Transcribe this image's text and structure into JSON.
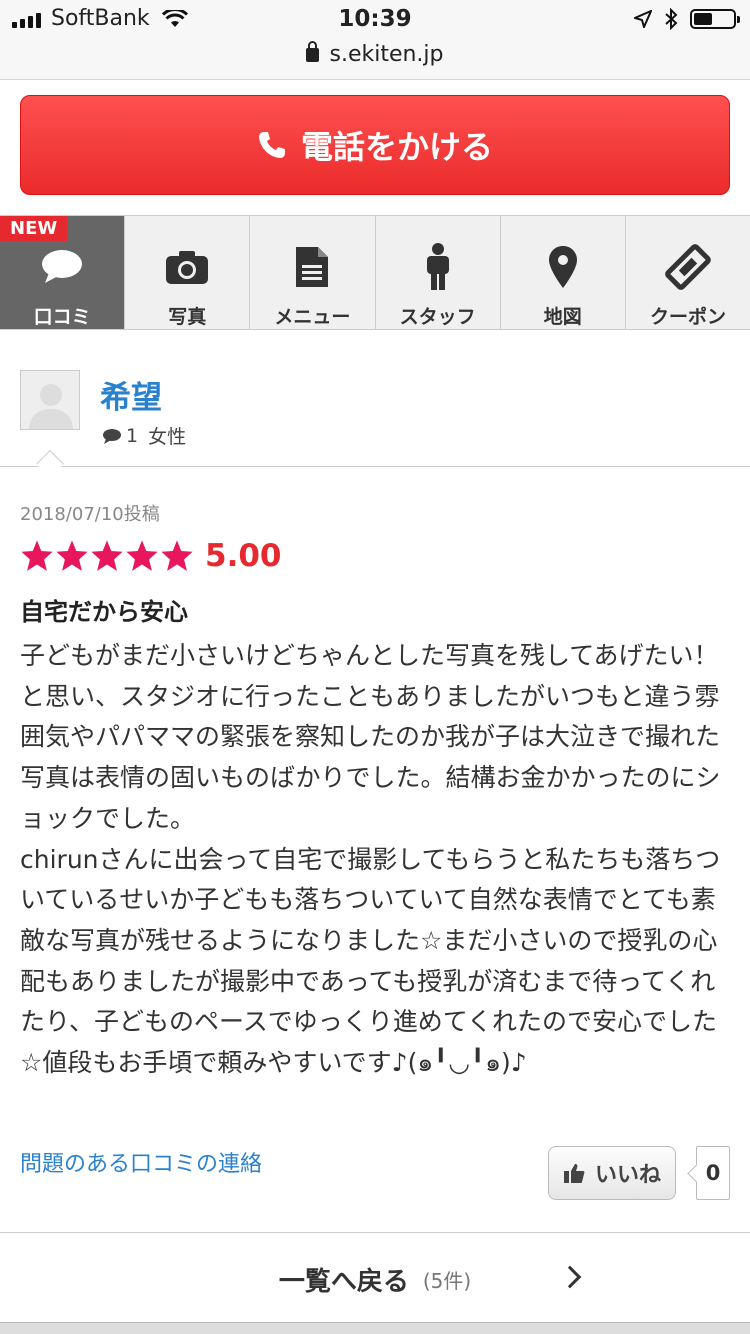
{
  "status_bar": {
    "carrier": "SoftBank",
    "time": "10:39",
    "url": "s.ekiten.jp"
  },
  "call_button": {
    "label": "電話をかける"
  },
  "tabs": [
    {
      "label": "口コミ",
      "icon": "speech-bubble-icon",
      "active": true,
      "badge": "NEW"
    },
    {
      "label": "写真",
      "icon": "camera-icon"
    },
    {
      "label": "メニュー",
      "icon": "document-icon"
    },
    {
      "label": "スタッフ",
      "icon": "person-icon"
    },
    {
      "label": "地図",
      "icon": "map-pin-icon"
    },
    {
      "label": "クーポン",
      "icon": "ticket-icon"
    }
  ],
  "reviewer": {
    "name": "希望",
    "review_count": "1",
    "gender": "女性"
  },
  "review": {
    "posted": "2018/07/10投稿",
    "rating": 5,
    "score": "5.00",
    "title": "自宅だから安心",
    "body": "子どもがまだ小さいけどちゃんとした写真を残してあげたい！と思い、スタジオに行ったこともありましたがいつもと違う雰囲気やパパママの緊張を察知したのか我が子は大泣きで撮れた写真は表情の固いものばかりでした。結構お金かかったのにショックでした。\nchirunさんに出会って自宅で撮影してもらうと私たちも落ちついているせいか子どもも落ちついていて自然な表情でとても素敵な写真が残せるようになりました☆まだ小さいので授乳の心配もありましたが撮影中であっても授乳が済むまで待ってくれたり、子どものペースでゆっくり進めてくれたので安心でした☆値段もお手頃で頼みやすいです♪(๑╹◡╹๑)♪"
  },
  "actions": {
    "report_link": "問題のある口コミの連絡",
    "like_label": "いいね",
    "like_count": "0"
  },
  "back_nav": {
    "label": "一覧へ戻る",
    "count": "(5件)"
  },
  "colors": {
    "accent_red": "#e5292f",
    "link_blue": "#2a82cf",
    "star_pink": "#e8175d"
  }
}
